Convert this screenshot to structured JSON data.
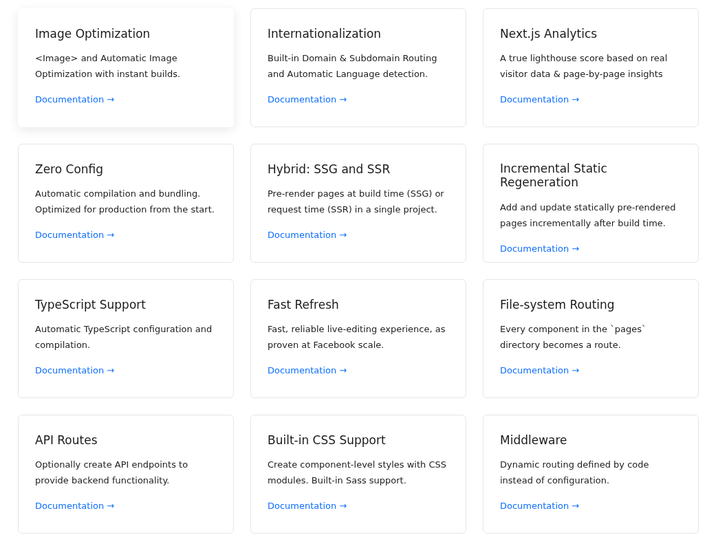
{
  "cards": [
    {
      "title": "Image Optimization",
      "description": "<Image> and Automatic Image Optimization with instant builds.",
      "link": "Documentation →",
      "hovered": true
    },
    {
      "title": "Internationalization",
      "description": "Built-in Domain & Subdomain Routing and Automatic Language detection.",
      "link": "Documentation →",
      "hovered": false
    },
    {
      "title": "Next.js Analytics",
      "description": "A true lighthouse score based on real visitor data & page-by-page insights",
      "link": "Documentation →",
      "hovered": false
    },
    {
      "title": "Zero Config",
      "description": "Automatic compilation and bundling. Optimized for production from the start.",
      "link": "Documentation →",
      "hovered": false
    },
    {
      "title": "Hybrid: SSG and SSR",
      "description": "Pre-render pages at build time (SSG) or request time (SSR) in a single project.",
      "link": "Documentation →",
      "hovered": false
    },
    {
      "title": "Incremental Static Regeneration",
      "description": "Add and update statically pre-rendered pages incrementally after build time.",
      "link": "Documentation →",
      "hovered": false
    },
    {
      "title": "TypeScript Support",
      "description": "Automatic TypeScript configuration and compilation.",
      "link": "Documentation →",
      "hovered": false
    },
    {
      "title": "Fast Refresh",
      "description": "Fast, reliable live-editing experience, as proven at Facebook scale.",
      "link": "Documentation →",
      "hovered": false
    },
    {
      "title": "File-system Routing",
      "description": "Every component in the `pages` directory becomes a route.",
      "link": "Documentation →",
      "hovered": false
    },
    {
      "title": "API Routes",
      "description": "Optionally create API endpoints to provide backend functionality.",
      "link": "Documentation →",
      "hovered": false
    },
    {
      "title": "Built-in CSS Support",
      "description": "Create component-level styles with CSS modules. Built-in Sass support.",
      "link": "Documentation →",
      "hovered": false
    },
    {
      "title": "Middleware",
      "description": "Dynamic routing defined by code instead of configuration.",
      "link": "Documentation →",
      "hovered": false
    }
  ]
}
